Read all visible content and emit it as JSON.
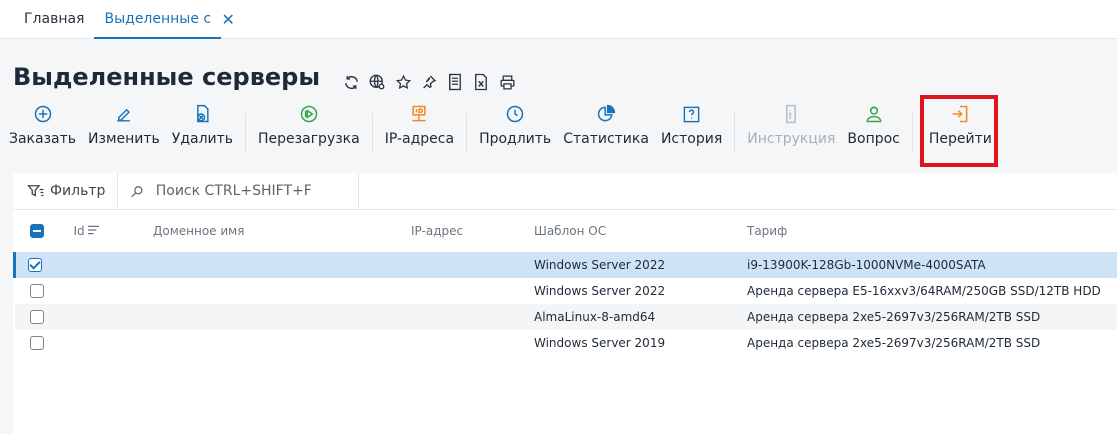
{
  "tabs": {
    "home": "Главная",
    "active": "Выделенные се...",
    "close": "✕"
  },
  "page": {
    "title": "Выделенные серверы"
  },
  "title_icons": [
    "refresh-icon",
    "globe-settings-icon",
    "star-icon",
    "pin-icon",
    "book-icon",
    "excel-icon",
    "print-icon"
  ],
  "toolbar": {
    "order": "Заказать",
    "edit": "Изменить",
    "delete": "Удалить",
    "reboot": "Перезагрузка",
    "ip": "IP-адреса",
    "extend": "Продлить",
    "stats": "Статистика",
    "history": "История",
    "instruction": "Инструкция",
    "question": "Вопрос",
    "goto": "Перейти"
  },
  "colors": {
    "accent": "#1a73b8",
    "orange": "#f08a24",
    "green": "#3aa34b",
    "highlight": "#e0141e",
    "selected_row": "#cfe3f7"
  },
  "filterbar": {
    "filter": "Фильтр",
    "search_placeholder": "Поиск CTRL+SHIFT+F"
  },
  "table": {
    "columns": {
      "id": "Id",
      "domain": "Доменное имя",
      "ip": "IP-адрес",
      "os": "Шаблон ОС",
      "tariff": "Тариф"
    },
    "rows": [
      {
        "checked": true,
        "os": "Windows Server 2022",
        "tariff": "i9-13900K-128Gb-1000NVMe-4000SATA"
      },
      {
        "checked": false,
        "os": "Windows Server 2022",
        "tariff": "Аренда сервера E5-16xxv3/64RAM/250GB SSD/12TB HDD"
      },
      {
        "checked": false,
        "os": "AlmaLinux-8-amd64",
        "tariff": "Аренда сервера 2xe5-2697v3/256RAM/2TB SSD"
      },
      {
        "checked": false,
        "os": "Windows Server 2019",
        "tariff": "Аренда сервера 2xe5-2697v3/256RAM/2TB SSD"
      }
    ]
  }
}
